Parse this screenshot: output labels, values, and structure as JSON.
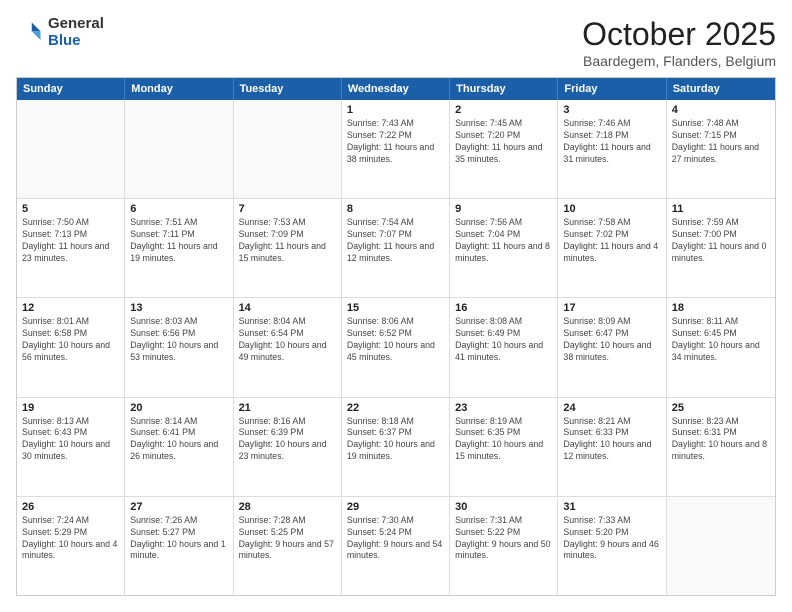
{
  "logo": {
    "general": "General",
    "blue": "Blue"
  },
  "title": "October 2025",
  "location": "Baardegem, Flanders, Belgium",
  "weekdays": [
    "Sunday",
    "Monday",
    "Tuesday",
    "Wednesday",
    "Thursday",
    "Friday",
    "Saturday"
  ],
  "weeks": [
    [
      {
        "day": "",
        "info": ""
      },
      {
        "day": "",
        "info": ""
      },
      {
        "day": "",
        "info": ""
      },
      {
        "day": "1",
        "info": "Sunrise: 7:43 AM\nSunset: 7:22 PM\nDaylight: 11 hours and 38 minutes."
      },
      {
        "day": "2",
        "info": "Sunrise: 7:45 AM\nSunset: 7:20 PM\nDaylight: 11 hours and 35 minutes."
      },
      {
        "day": "3",
        "info": "Sunrise: 7:46 AM\nSunset: 7:18 PM\nDaylight: 11 hours and 31 minutes."
      },
      {
        "day": "4",
        "info": "Sunrise: 7:48 AM\nSunset: 7:15 PM\nDaylight: 11 hours and 27 minutes."
      }
    ],
    [
      {
        "day": "5",
        "info": "Sunrise: 7:50 AM\nSunset: 7:13 PM\nDaylight: 11 hours and 23 minutes."
      },
      {
        "day": "6",
        "info": "Sunrise: 7:51 AM\nSunset: 7:11 PM\nDaylight: 11 hours and 19 minutes."
      },
      {
        "day": "7",
        "info": "Sunrise: 7:53 AM\nSunset: 7:09 PM\nDaylight: 11 hours and 15 minutes."
      },
      {
        "day": "8",
        "info": "Sunrise: 7:54 AM\nSunset: 7:07 PM\nDaylight: 11 hours and 12 minutes."
      },
      {
        "day": "9",
        "info": "Sunrise: 7:56 AM\nSunset: 7:04 PM\nDaylight: 11 hours and 8 minutes."
      },
      {
        "day": "10",
        "info": "Sunrise: 7:58 AM\nSunset: 7:02 PM\nDaylight: 11 hours and 4 minutes."
      },
      {
        "day": "11",
        "info": "Sunrise: 7:59 AM\nSunset: 7:00 PM\nDaylight: 11 hours and 0 minutes."
      }
    ],
    [
      {
        "day": "12",
        "info": "Sunrise: 8:01 AM\nSunset: 6:58 PM\nDaylight: 10 hours and 56 minutes."
      },
      {
        "day": "13",
        "info": "Sunrise: 8:03 AM\nSunset: 6:56 PM\nDaylight: 10 hours and 53 minutes."
      },
      {
        "day": "14",
        "info": "Sunrise: 8:04 AM\nSunset: 6:54 PM\nDaylight: 10 hours and 49 minutes."
      },
      {
        "day": "15",
        "info": "Sunrise: 8:06 AM\nSunset: 6:52 PM\nDaylight: 10 hours and 45 minutes."
      },
      {
        "day": "16",
        "info": "Sunrise: 8:08 AM\nSunset: 6:49 PM\nDaylight: 10 hours and 41 minutes."
      },
      {
        "day": "17",
        "info": "Sunrise: 8:09 AM\nSunset: 6:47 PM\nDaylight: 10 hours and 38 minutes."
      },
      {
        "day": "18",
        "info": "Sunrise: 8:11 AM\nSunset: 6:45 PM\nDaylight: 10 hours and 34 minutes."
      }
    ],
    [
      {
        "day": "19",
        "info": "Sunrise: 8:13 AM\nSunset: 6:43 PM\nDaylight: 10 hours and 30 minutes."
      },
      {
        "day": "20",
        "info": "Sunrise: 8:14 AM\nSunset: 6:41 PM\nDaylight: 10 hours and 26 minutes."
      },
      {
        "day": "21",
        "info": "Sunrise: 8:16 AM\nSunset: 6:39 PM\nDaylight: 10 hours and 23 minutes."
      },
      {
        "day": "22",
        "info": "Sunrise: 8:18 AM\nSunset: 6:37 PM\nDaylight: 10 hours and 19 minutes."
      },
      {
        "day": "23",
        "info": "Sunrise: 8:19 AM\nSunset: 6:35 PM\nDaylight: 10 hours and 15 minutes."
      },
      {
        "day": "24",
        "info": "Sunrise: 8:21 AM\nSunset: 6:33 PM\nDaylight: 10 hours and 12 minutes."
      },
      {
        "day": "25",
        "info": "Sunrise: 8:23 AM\nSunset: 6:31 PM\nDaylight: 10 hours and 8 minutes."
      }
    ],
    [
      {
        "day": "26",
        "info": "Sunrise: 7:24 AM\nSunset: 5:29 PM\nDaylight: 10 hours and 4 minutes."
      },
      {
        "day": "27",
        "info": "Sunrise: 7:26 AM\nSunset: 5:27 PM\nDaylight: 10 hours and 1 minute."
      },
      {
        "day": "28",
        "info": "Sunrise: 7:28 AM\nSunset: 5:25 PM\nDaylight: 9 hours and 57 minutes."
      },
      {
        "day": "29",
        "info": "Sunrise: 7:30 AM\nSunset: 5:24 PM\nDaylight: 9 hours and 54 minutes."
      },
      {
        "day": "30",
        "info": "Sunrise: 7:31 AM\nSunset: 5:22 PM\nDaylight: 9 hours and 50 minutes."
      },
      {
        "day": "31",
        "info": "Sunrise: 7:33 AM\nSunset: 5:20 PM\nDaylight: 9 hours and 46 minutes."
      },
      {
        "day": "",
        "info": ""
      }
    ]
  ]
}
